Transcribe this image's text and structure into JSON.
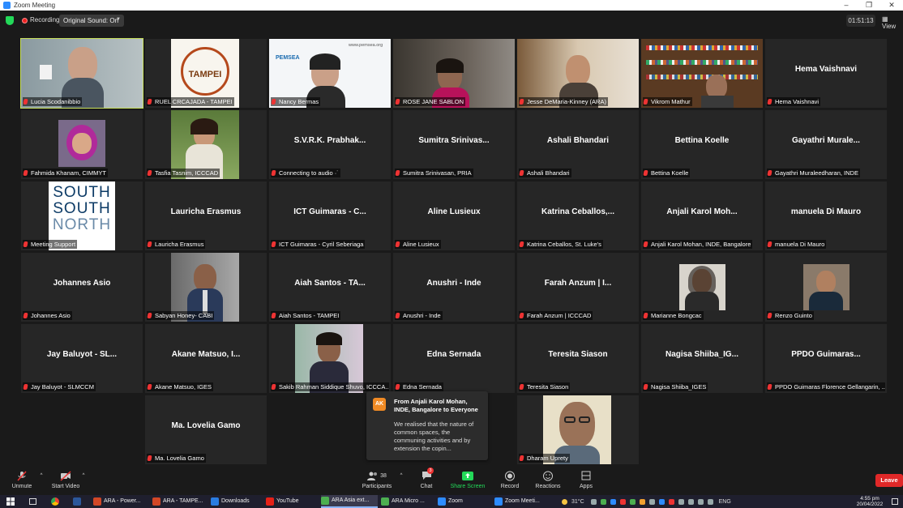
{
  "window": {
    "title": "Zoom Meeting"
  },
  "topbar": {
    "recording": "Recording",
    "sound": "Original Sound: On",
    "timer": "01:51:13",
    "view": "View"
  },
  "tiles": [
    {
      "label": "Lucia Scodanibbio",
      "name": "",
      "video": true
    },
    {
      "label": "RUEL CRCAJADA - TAMPEI",
      "name": "",
      "video": true
    },
    {
      "label": "Nancy Bermas",
      "name": "",
      "video": true
    },
    {
      "label": "ROSE JANE SABLON",
      "name": "",
      "video": true
    },
    {
      "label": "Jesse DeMaria-Kinney (ARA)",
      "name": "",
      "video": true
    },
    {
      "label": "Vikrom Mathur",
      "name": "",
      "video": true
    },
    {
      "label": "Hema Vaishnavi",
      "name": "Hema Vaishnavi",
      "video": false
    },
    {
      "label": "Fahmida Khanam, CIMMYT",
      "name": "",
      "video": true
    },
    {
      "label": "Tasfia Tasnim, ICCCAD",
      "name": "",
      "video": true
    },
    {
      "label": "Connecting to audio ·˙",
      "name": "S.V.R.K. Prabhak...",
      "video": false
    },
    {
      "label": "Sumitra Srinivasan, PRIA",
      "name": "Sumitra Srinivas...",
      "video": false
    },
    {
      "label": "Ashali Bhandari",
      "name": "Ashali Bhandari",
      "video": false
    },
    {
      "label": "Bettina Koelle",
      "name": "Bettina Koelle",
      "video": false
    },
    {
      "label": "Gayathri Muraleedharan, INDE",
      "name": "Gayathri Murale...",
      "video": false
    },
    {
      "label": "Meeting Support",
      "name": "",
      "video": true
    },
    {
      "label": "Lauricha Erasmus",
      "name": "Lauricha Erasmus",
      "video": false
    },
    {
      "label": "ICT Guimaras - Cyril Seberiaga",
      "name": "ICT Guimaras - C...",
      "video": false
    },
    {
      "label": "Aline Lusieux",
      "name": "Aline Lusieux",
      "video": false
    },
    {
      "label": "Katrina Ceballos, St. Luke's",
      "name": "Katrina  Ceballos,...",
      "video": false
    },
    {
      "label": "Anjali Karol Mohan, INDE, Bangalore",
      "name": "Anjali Karol Moh...",
      "video": false
    },
    {
      "label": "manuela Di Mauro",
      "name": "manuela Di Mauro",
      "video": false
    },
    {
      "label": "Johannes Asio",
      "name": "Johannes Asio",
      "video": false
    },
    {
      "label": "Sabyan Honey- CABI",
      "name": "",
      "video": true
    },
    {
      "label": "Aiah Santos - TAMPEI",
      "name": "Aiah Santos - TA...",
      "video": false
    },
    {
      "label": "Anushri - Inde",
      "name": "Anushri - Inde",
      "video": false
    },
    {
      "label": "Farah Anzum | ICCCAD",
      "name": "Farah Anzum | I...",
      "video": false
    },
    {
      "label": "Marianne Bongcac",
      "name": "",
      "video": true
    },
    {
      "label": "Renzo Guinto",
      "name": "",
      "video": true
    },
    {
      "label": "Jay Baluyot - SLMCCM",
      "name": "Jay Baluyot - SL...",
      "video": false
    },
    {
      "label": "Akane Matsuo, IGES",
      "name": "Akane Matsuo, I...",
      "video": false
    },
    {
      "label": "Sakib Rahman Siddique Shuvo, ICCCA...",
      "name": "",
      "video": true
    },
    {
      "label": "Edna Sernada",
      "name": "Edna Sernada",
      "video": false
    },
    {
      "label": "Teresita Siason",
      "name": "Teresita Siason",
      "video": false
    },
    {
      "label": "Nagisa Shiiba_IGES",
      "name": "Nagisa Shiiba_IG...",
      "video": false
    },
    {
      "label": "PPDO Guimaras Florence Gellangarin, ...",
      "name": "PPDO Guimaras...",
      "video": false
    },
    {
      "label": "",
      "name": "",
      "video": false,
      "empty": true
    },
    {
      "label": "Ma. Lovelia Gamo",
      "name": "Ma. Lovelia Gamo",
      "video": false
    },
    {
      "label": "",
      "name": "",
      "video": false,
      "empty": true
    },
    {
      "label": "",
      "name": "",
      "video": false,
      "empty": true
    },
    {
      "label": "Dharam Uprety",
      "name": "",
      "video": true
    }
  ],
  "tile_art": {
    "logo_tampei": "TAMPEI",
    "logo_pemsea": "PEMSEA",
    "logo_pemsea_url": "www.pemsea.org",
    "logo_ssn_1": "SOUTH",
    "logo_ssn_2": "SOUTH",
    "logo_ssn_3": "NORTH"
  },
  "chat_toast": {
    "avatar": "AK",
    "from": "From Anjali Karol Mohan, INDE, Bangalore to Everyone",
    "message": "We realised that the nature of common spaces, the communing activities and by extension the copin..."
  },
  "toolbar": {
    "unmute": "Unmute",
    "start_video": "Start Video",
    "participants": "Participants",
    "participants_count": "38",
    "chat": "Chat",
    "chat_badge": "3",
    "share": "Share Screen",
    "record": "Record",
    "reactions": "Reactions",
    "apps": "Apps",
    "leave": "Leave"
  },
  "taskbar": {
    "apps": [
      {
        "label": "ARA - Power...",
        "color": "#d24726"
      },
      {
        "label": "ARA - TAMPE...",
        "color": "#d24726"
      },
      {
        "label": "Downloads",
        "color": "#2a7de1"
      },
      {
        "label": "YouTube",
        "color": "#e62117"
      },
      {
        "label": "ARA Asia ext...",
        "color": "#4caf50"
      },
      {
        "label": "ARA Micro ...",
        "color": "#4caf50"
      },
      {
        "label": "Zoom",
        "color": "#2d8cff"
      },
      {
        "label": "Zoom Meeti...",
        "color": "#2d8cff"
      }
    ],
    "weather": "31°C",
    "lang": "ENG",
    "time": "4:55 pm",
    "date": "20/04/2022"
  }
}
